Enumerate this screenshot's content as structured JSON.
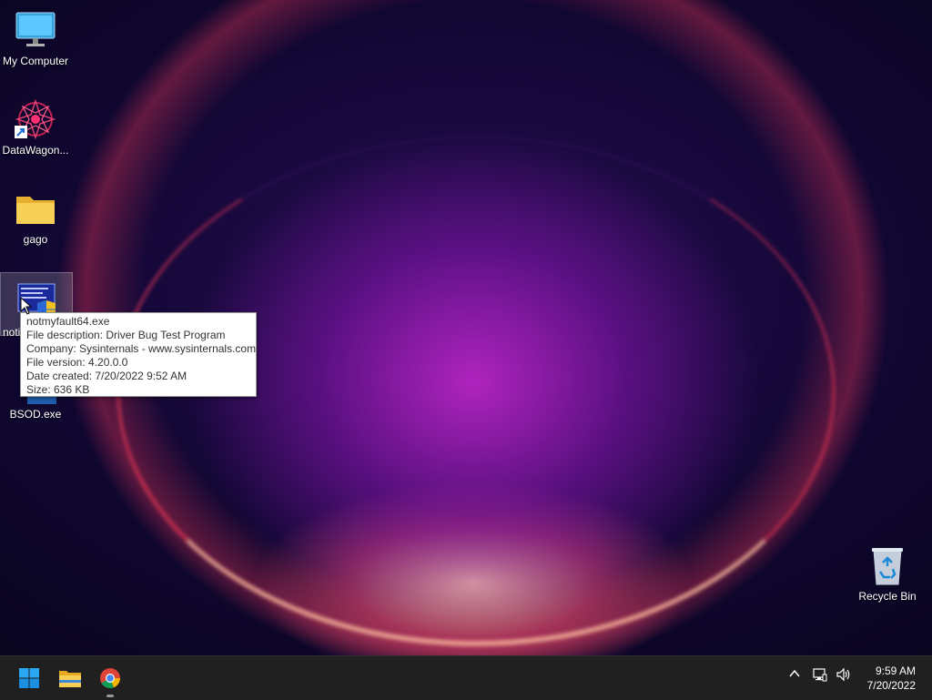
{
  "desktop": {
    "icons": [
      {
        "label": "My Computer",
        "icon": "monitor-icon"
      },
      {
        "label": "DataWagon...",
        "icon": "app-shortcut-icon"
      },
      {
        "label": "gago",
        "icon": "folder-icon"
      },
      {
        "label": "noti",
        "icon": "exe-shield-icon"
      },
      {
        "label": "BSOD.exe",
        "icon": "exe-icon"
      },
      {
        "label": "Recycle Bin",
        "icon": "recycle-bin-icon"
      }
    ]
  },
  "tooltip": {
    "lines": [
      "notmyfault64.exe",
      "File description: Driver Bug Test Program",
      "Company: Sysinternals - www.sysinternals.com",
      "File version: 4.20.0.0",
      "Date created: 7/20/2022 9:52 AM",
      "Size: 636 KB"
    ]
  },
  "taskbar": {
    "apps": [
      "windows-start-icon",
      "file-explorer-icon",
      "chrome-icon"
    ],
    "tray": [
      "chevron-up-icon",
      "network-icon",
      "volume-icon"
    ],
    "time": "9:59 AM",
    "date": "7/20/2022"
  },
  "colors": {
    "taskbar": "#202020",
    "folder": "#f5c842",
    "start_blue": "#1b9ef0"
  }
}
